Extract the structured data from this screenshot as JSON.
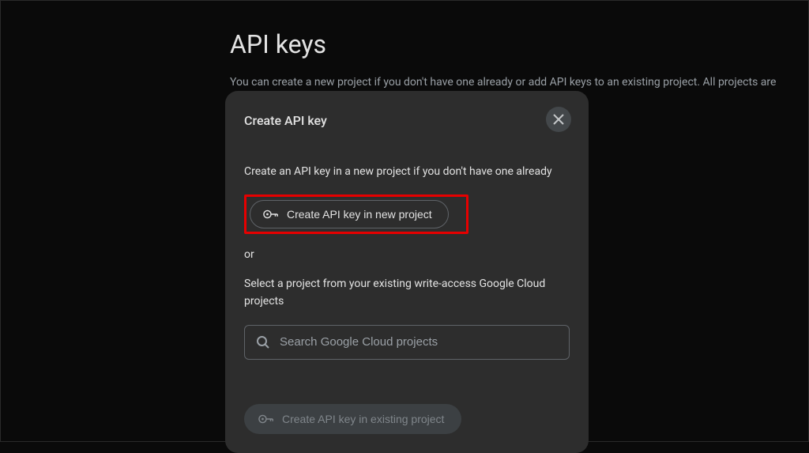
{
  "page": {
    "title": "API keys",
    "description": "You can create a new project if you don't have one already or add API keys to an existing project. All projects are"
  },
  "modal": {
    "title": "Create API key",
    "instruction_new": "Create an API key in a new project if you don't have one already",
    "new_project_button": "Create API key in new project",
    "or_label": "or",
    "instruction_existing": "Select a project from your existing write-access Google Cloud projects",
    "search_placeholder": "Search Google Cloud projects",
    "existing_project_button": "Create API key in existing project"
  }
}
